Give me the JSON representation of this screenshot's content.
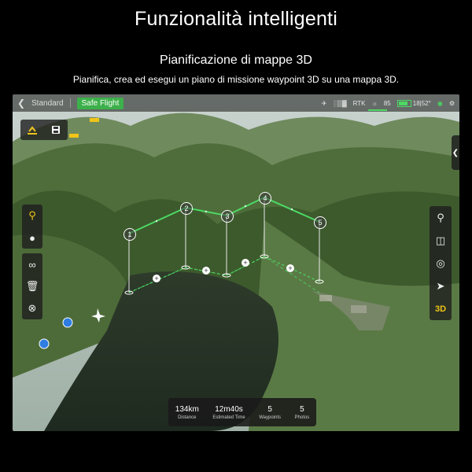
{
  "headline": "Funzionalità intelligenti",
  "subheadline": "Pianificazione di mappe 3D",
  "description": "Pianifica, crea ed esegui un piano di missione waypoint 3D su una mappa 3D.",
  "topbar": {
    "mode": "Standard",
    "safe_flight": "Safe Flight",
    "rtk": "RTK",
    "value_85": "85",
    "battery_text": "18|52°",
    "accent": "#3cb04a"
  },
  "waypoints": [
    {
      "id": "1"
    },
    {
      "id": "2"
    },
    {
      "id": "3"
    },
    {
      "id": "4"
    },
    {
      "id": "5"
    }
  ],
  "right_tools": {
    "view_3d": "3D"
  },
  "stats": [
    {
      "value": "134km",
      "label": "Distance"
    },
    {
      "value": "12m40s",
      "label": "Estimated Time"
    },
    {
      "value": "5",
      "label": "Waypoints"
    },
    {
      "value": "5",
      "label": "Photos"
    }
  ],
  "colors": {
    "route": "#4cd964",
    "highlight": "#f0c419",
    "location_pin": "#2f7de1"
  }
}
